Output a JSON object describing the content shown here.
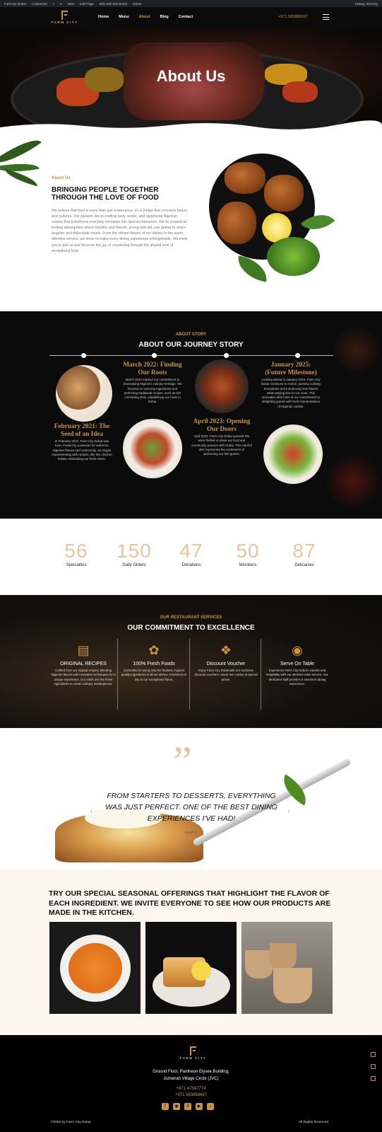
{
  "admin_bar": {
    "items": [
      "Farmcity Dubai",
      "Customize",
      "1",
      "0",
      "New",
      "Edit Page",
      "Edit with Elementor",
      "Notes"
    ],
    "greeting": "Howdy, farmcity"
  },
  "header": {
    "logo_text": "FARM CITY",
    "nav": [
      "Home",
      "Menu",
      "About",
      "Blog",
      "Contact"
    ],
    "active": "About",
    "phone": "+971 565886607"
  },
  "hero": {
    "title": "About Us"
  },
  "about": {
    "kicker": "About Us",
    "title": "BRINGING PEOPLE TOGETHER THROUGH THE LOVE OF FOOD",
    "text": "We believe that food is more than just sustenance; it's a bridge that connects hearts and cultures. Our passion lies in crafting tasty, exotic, and appetizing Nigerian cuisine that transforms everyday moments into special memories. We've created an inviting atmosphere where families and friends, young and old, can gather to share laughter and delectable meals. From the vibrant flavors of our dishes to the warm, attentive service, we strive to make every dining experience unforgettable. We invite you to join us and discover the joy of connecting through the shared love of exceptional food."
  },
  "story": {
    "kicker": "ABOUT STORY",
    "title": "ABOUT OUR JOURNEY STORY",
    "events": [
      {
        "title": "February 2021: The Seed of an Idea",
        "text": "In February 2021, Farm City Dubai was born. Fueled by a passion for authentic Nigerian flavors and community, we began experimenting with recipes, like this chicken kebab, embodying our fresh vision."
      },
      {
        "title": "March 2022: Finding Our Roots",
        "text": "March 2022 marked our commitment to showcasing Nigeria's culinary heritage. We focused on sourcing ingredients and perfecting traditional recipes, such as this comforting stew, establishing our roots in Dubai."
      },
      {
        "title": "April 2023: Opening Our Doors",
        "text": "April 2023: Farm City Dubai opened! We were thrilled to share our food and community passion with Dubai. This colorful dish represents the excitement of welcoming our first guests."
      },
      {
        "title": "January 2025: (Future Milestone)",
        "text": "Looking ahead to January 2025, Farm City Dubai continues to evolve, pushing culinary boundaries and introducing new flavors while staying true to our roots. This innovative dish hints at our commitment to delighting guests with fresh interpretations of Nigerian cuisine."
      }
    ]
  },
  "stats": [
    {
      "num": "56",
      "label": "Specialties"
    },
    {
      "num": "150",
      "label": "Daily Orders"
    },
    {
      "num": "47",
      "label": "Donations"
    },
    {
      "num": "50",
      "label": "Members"
    },
    {
      "num": "87",
      "label": "Delicacies"
    }
  ],
  "services": {
    "kicker": "OUR RESTAURANT SERVICES",
    "title": "OUR COMMITMENT TO EXCELLENCE",
    "items": [
      {
        "icon": "recipe-book-icon",
        "title": "ORIGINAL RECIPES",
        "text": "Crafted from our original recipes, blending Nigerian flavors with innovative techniques for a unique experience. Our chefs use the finest ingredients to create culinary masterpieces."
      },
      {
        "icon": "fresh-food-icon",
        "title": "100% Fresh Foods",
        "text": "Committed to using only the freshest, highest quality ingredients in all our dishes. Freshness is key to our exceptional flavor."
      },
      {
        "icon": "discount-tag-icon",
        "title": "Discount Voucher",
        "text": "Enjoy Farm City Dubai with our exclusive discount vouchers. Savor our cuisine at special prices."
      },
      {
        "icon": "serving-cloche-icon",
        "title": "Serve On Table",
        "text": "Experience Farm City Dubai's warmth and hospitality with our attentive table service. Our dedicated staff provides a seamless dining experience."
      }
    ]
  },
  "testimonial": {
    "quote": "FROM STARTERS TO DESSERTS, EVERYTHING WAS JUST PERFECT. ONE OF THE BEST DINING EXPERIENCES I'VE HAD!",
    "author": "David R."
  },
  "seasonal": {
    "title": "TRY OUR SPECIAL SEASONAL OFFERINGS THAT HIGHLIGHT THE FLAVOR OF EACH INGREDIENT. WE INVITE EVERYONE TO SEE HOW OUR PRODUCTS ARE MADE IN THE KITCHEN."
  },
  "footer": {
    "logo_text": "FARM CITY",
    "address_1": "Ground Floor, Pantheon Elysee Building,",
    "address_2": "Jumeirah Village Circle (JVC)",
    "phone_1": "+971 47567774",
    "phone_2": "+971 583888667",
    "copyright": "©2025 by Farm City Dubai",
    "rights": "All Rights Reserved"
  },
  "colors": {
    "accent": "#c9953f",
    "dark": "#0b0b0b"
  }
}
